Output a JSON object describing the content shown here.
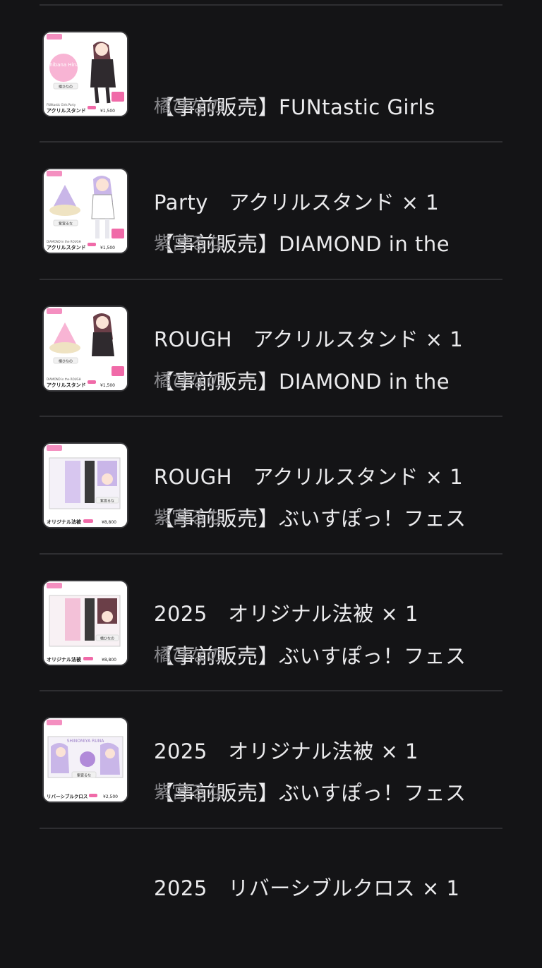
{
  "orders": [
    {
      "title": "【事前販売】FUNtastic Girls Party　アクリルスタンド × 1",
      "title_line1": "【事前販売】FUNtastic Girls",
      "title_line2": "Party　アクリルスタンド × 1",
      "member": "橘ひなの",
      "thumb": {
        "caption_small": "FUNtastic Girls Party",
        "caption": "アクリルスタンド",
        "price": "¥1,500",
        "name_tag": "橘ひなの",
        "badge_text": "Tachibana Hinano",
        "accent": "#f06aa8",
        "hair": "#6b3f48"
      }
    },
    {
      "title": "【事前販売】DIAMOND in the ROUGH　アクリルスタンド × 1",
      "title_line1": "【事前販売】DIAMOND in the",
      "title_line2": "ROUGH　アクリルスタンド × 1",
      "member": "紫宮るな",
      "thumb": {
        "caption_small": "DIAMOND in the ROUGH",
        "caption": "アクリルスタンド",
        "price": "¥1,500",
        "name_tag": "紫宮るな",
        "accent": "#b18ad9",
        "hair": "#c9b6e8"
      }
    },
    {
      "title": "【事前販売】DIAMOND in the ROUGH　アクリルスタンド × 1",
      "title_line1": "【事前販売】DIAMOND in the",
      "title_line2": "ROUGH　アクリルスタンド × 1",
      "member": "橘ひなの",
      "thumb": {
        "caption_small": "DIAMOND in the ROUGH",
        "caption": "アクリルスタンド",
        "price": "¥1,500",
        "name_tag": "橘ひなの",
        "accent": "#f06aa8",
        "hair": "#6b3f48"
      }
    },
    {
      "title": "【事前販売】ぶいすぽっ！フェス 2025　オリジナル法被 × 1",
      "title_line1": "【事前販売】ぶいすぽっ！フェス",
      "title_line2": "2025　オリジナル法被 × 1",
      "member": "紫宮るな",
      "thumb": {
        "caption": "オリジナル法被",
        "price": "¥8,800",
        "name_tag": "紫宮るな",
        "accent": "#b18ad9",
        "hair": "#c9b6e8"
      }
    },
    {
      "title": "【事前販売】ぶいすぽっ！フェス 2025　オリジナル法被 × 1",
      "title_line1": "【事前販売】ぶいすぽっ！フェス",
      "title_line2": "2025　オリジナル法被 × 1",
      "member": "橘ひなの",
      "thumb": {
        "caption": "オリジナル法被",
        "price": "¥8,800",
        "name_tag": "橘ひなの",
        "accent": "#f06aa8",
        "hair": "#6b3f48"
      }
    },
    {
      "title": "【事前販売】ぶいすぽっ！フェス 2025　リバーシブルクロス × 1",
      "title_line1": "【事前販売】ぶいすぽっ！フェス",
      "title_line2": "2025　リバーシブルクロス × 1",
      "member": "紫宮るな",
      "thumb": {
        "caption": "リバーシブルクロス",
        "price": "¥2,500",
        "name_tag": "紫宮るな",
        "badge_text": "SHINOMIYA RUNA",
        "accent": "#b18ad9",
        "hair": "#c9b6e8"
      }
    }
  ]
}
